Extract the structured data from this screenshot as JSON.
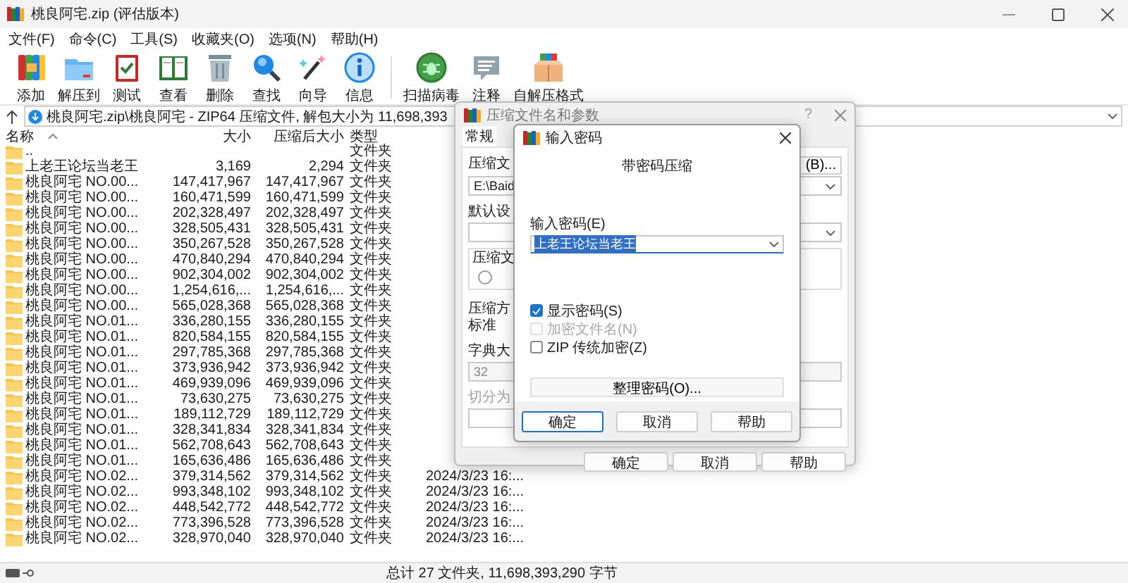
{
  "window": {
    "title": "桃良阿宅.zip (评估版本)"
  },
  "menu": [
    "文件(F)",
    "命令(C)",
    "工具(S)",
    "收藏夹(O)",
    "选项(N)",
    "帮助(H)"
  ],
  "toolbar": {
    "groups": [
      [
        {
          "label": "添加",
          "kind": "add"
        },
        {
          "label": "解压到",
          "kind": "extract"
        },
        {
          "label": "测试",
          "kind": "test"
        },
        {
          "label": "查看",
          "kind": "view"
        },
        {
          "label": "删除",
          "kind": "delete"
        },
        {
          "label": "查找",
          "kind": "find"
        },
        {
          "label": "向导",
          "kind": "wizard"
        },
        {
          "label": "信息",
          "kind": "info"
        }
      ],
      [
        {
          "label": "扫描病毒",
          "kind": "scan"
        },
        {
          "label": "注释",
          "kind": "comment"
        },
        {
          "label": "自解压格式",
          "kind": "sfx"
        }
      ]
    ]
  },
  "address": {
    "path": "桃良阿宅.zip\\桃良阿宅 - ZIP64 压缩文件, 解包大小为 11,698,393"
  },
  "file_list": {
    "columns": [
      "名称",
      "大小",
      "压缩后大小",
      "类型"
    ],
    "rows": [
      {
        "name": "..",
        "type": "文件夹"
      },
      {
        "name": "上老王论坛当老王",
        "size": "3,169",
        "packed": "2,294",
        "type": "文件夹"
      },
      {
        "name": "桃良阿宅 NO.00...",
        "size": "147,417,967",
        "packed": "147,417,967",
        "type": "文件夹"
      },
      {
        "name": "桃良阿宅 NO.00...",
        "size": "160,471,599",
        "packed": "160,471,599",
        "type": "文件夹"
      },
      {
        "name": "桃良阿宅 NO.00...",
        "size": "202,328,497",
        "packed": "202,328,497",
        "type": "文件夹"
      },
      {
        "name": "桃良阿宅 NO.00...",
        "size": "328,505,431",
        "packed": "328,505,431",
        "type": "文件夹"
      },
      {
        "name": "桃良阿宅 NO.00...",
        "size": "350,267,528",
        "packed": "350,267,528",
        "type": "文件夹"
      },
      {
        "name": "桃良阿宅 NO.00...",
        "size": "470,840,294",
        "packed": "470,840,294",
        "type": "文件夹"
      },
      {
        "name": "桃良阿宅 NO.00...",
        "size": "902,304,002",
        "packed": "902,304,002",
        "type": "文件夹"
      },
      {
        "name": "桃良阿宅 NO.00...",
        "size": "1,254,616,...",
        "packed": "1,254,616,...",
        "type": "文件夹"
      },
      {
        "name": "桃良阿宅 NO.00...",
        "size": "565,028,368",
        "packed": "565,028,368",
        "type": "文件夹"
      },
      {
        "name": "桃良阿宅 NO.01...",
        "size": "336,280,155",
        "packed": "336,280,155",
        "type": "文件夹"
      },
      {
        "name": "桃良阿宅 NO.01...",
        "size": "820,584,155",
        "packed": "820,584,155",
        "type": "文件夹"
      },
      {
        "name": "桃良阿宅 NO.01...",
        "size": "297,785,368",
        "packed": "297,785,368",
        "type": "文件夹"
      },
      {
        "name": "桃良阿宅 NO.01...",
        "size": "373,936,942",
        "packed": "373,936,942",
        "type": "文件夹"
      },
      {
        "name": "桃良阿宅 NO.01...",
        "size": "469,939,096",
        "packed": "469,939,096",
        "type": "文件夹"
      },
      {
        "name": "桃良阿宅 NO.01...",
        "size": "73,630,275",
        "packed": "73,630,275",
        "type": "文件夹"
      },
      {
        "name": "桃良阿宅 NO.01...",
        "size": "189,112,729",
        "packed": "189,112,729",
        "type": "文件夹"
      },
      {
        "name": "桃良阿宅 NO.01...",
        "size": "328,341,834",
        "packed": "328,341,834",
        "type": "文件夹"
      },
      {
        "name": "桃良阿宅 NO.01...",
        "size": "562,708,643",
        "packed": "562,708,643",
        "type": "文件夹"
      },
      {
        "name": "桃良阿宅 NO.01...",
        "size": "165,636,486",
        "packed": "165,636,486",
        "type": "文件夹"
      },
      {
        "name": "桃良阿宅 NO.02...",
        "size": "379,314,562",
        "packed": "379,314,562",
        "type": "文件夹",
        "modified": "2024/3/23 16:..."
      },
      {
        "name": "桃良阿宅 NO.02...",
        "size": "993,348,102",
        "packed": "993,348,102",
        "type": "文件夹",
        "modified": "2024/3/23 16:..."
      },
      {
        "name": "桃良阿宅 NO.02...",
        "size": "448,542,772",
        "packed": "448,542,772",
        "type": "文件夹",
        "modified": "2024/3/23 16:..."
      },
      {
        "name": "桃良阿宅 NO.02...",
        "size": "773,396,528",
        "packed": "773,396,528",
        "type": "文件夹",
        "modified": "2024/3/23 16:..."
      },
      {
        "name": "桃良阿宅 NO.02...",
        "size": "328,970,040",
        "packed": "328,970,040",
        "type": "文件夹",
        "modified": "2024/3/23 16:..."
      }
    ]
  },
  "status_bar": {
    "text": "总计 27 文件夹, 11,698,393,290 字节"
  },
  "archive_dialog": {
    "title": "压缩文件名和参数",
    "help_glyph": "?",
    "tabs": [
      {
        "label": "常规",
        "selected": true
      }
    ],
    "archive_label": "压缩文",
    "browse_button": "(B)...",
    "archive_path": "E:\\Baid",
    "profile_label": "默认设",
    "format_group_label": "压缩文",
    "format_option": {
      "selected": false
    },
    "method_label": "压缩方",
    "method_value": "标准",
    "dictionary_label": "字典大",
    "dictionary_value": "32",
    "split_label": "切分为",
    "split_disabled": true,
    "buttons": [
      {
        "label": "确定",
        "focused": false
      },
      {
        "label": "取消",
        "focused": false
      },
      {
        "label": "帮助",
        "focused": false
      }
    ]
  },
  "password_dialog": {
    "title": "输入密码",
    "heading": "带密码压缩",
    "password": {
      "label": "输入密码(E)",
      "value": "上老王论坛当老王",
      "highlighted": true
    },
    "options": [
      {
        "label": "显示密码(S)",
        "checked": true,
        "disabled": false
      },
      {
        "label": "加密文件名(N)",
        "checked": false,
        "disabled": true
      },
      {
        "label": "ZIP 传统加密(Z)",
        "checked": false,
        "disabled": false
      }
    ],
    "manage_button": "整理密码(O)...",
    "buttons": [
      {
        "label": "确定",
        "focused": true
      },
      {
        "label": "取消",
        "focused": false
      },
      {
        "label": "帮助",
        "focused": false
      }
    ]
  }
}
